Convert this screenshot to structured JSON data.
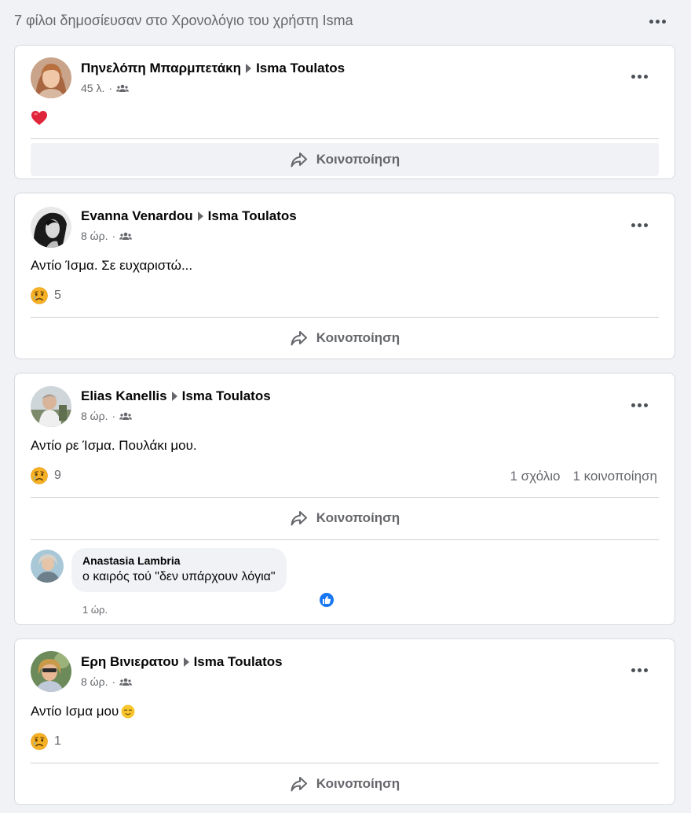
{
  "header": {
    "title": "7 φίλοι δημοσίευσαν στο Χρονολόγιο του χρήστη Isma"
  },
  "colors": {
    "accent": "#1877f2",
    "secondary_text": "#65676b",
    "background": "#f0f2f5"
  },
  "posts": [
    {
      "author": "Πηνελόπη Μπαρμπετάκη",
      "target": "Isma Toulatos",
      "time": "45 λ.",
      "separator": "·",
      "text": "",
      "emoji": "❤️",
      "reaction_count": "",
      "share_label": "Κοινοποίηση"
    },
    {
      "author": "Evanna Venardou",
      "target": "Isma Toulatos",
      "time": "8 ώρ.",
      "separator": "·",
      "text": "Αντίο Ίσμα. Σε ευχαριστώ...",
      "reaction_count": "5",
      "share_label": "Κοινοποίηση"
    },
    {
      "author": "Elias Kanellis",
      "target": "Isma Toulatos",
      "time": "8 ώρ.",
      "separator": "·",
      "text": "Αντίο ρε Ίσμα. Πουλάκι μου.",
      "reaction_count": "9",
      "comments_count": "1 σχόλιο",
      "shares_count": "1 κοινοποίηση",
      "share_label": "Κοινοποίηση",
      "comment": {
        "author": "Anastasia Lambria",
        "text": "ο καιρός τού \"δεν υπάρχουν λόγια\"",
        "time": "1 ώρ."
      }
    },
    {
      "author": "Ερη Βινιερατου",
      "target": "Isma Toulatos",
      "time": "8 ώρ.",
      "separator": "·",
      "text": "Αντίο Ισμα μου",
      "reaction_count": "1",
      "share_label": "Κοινοποίηση"
    }
  ]
}
